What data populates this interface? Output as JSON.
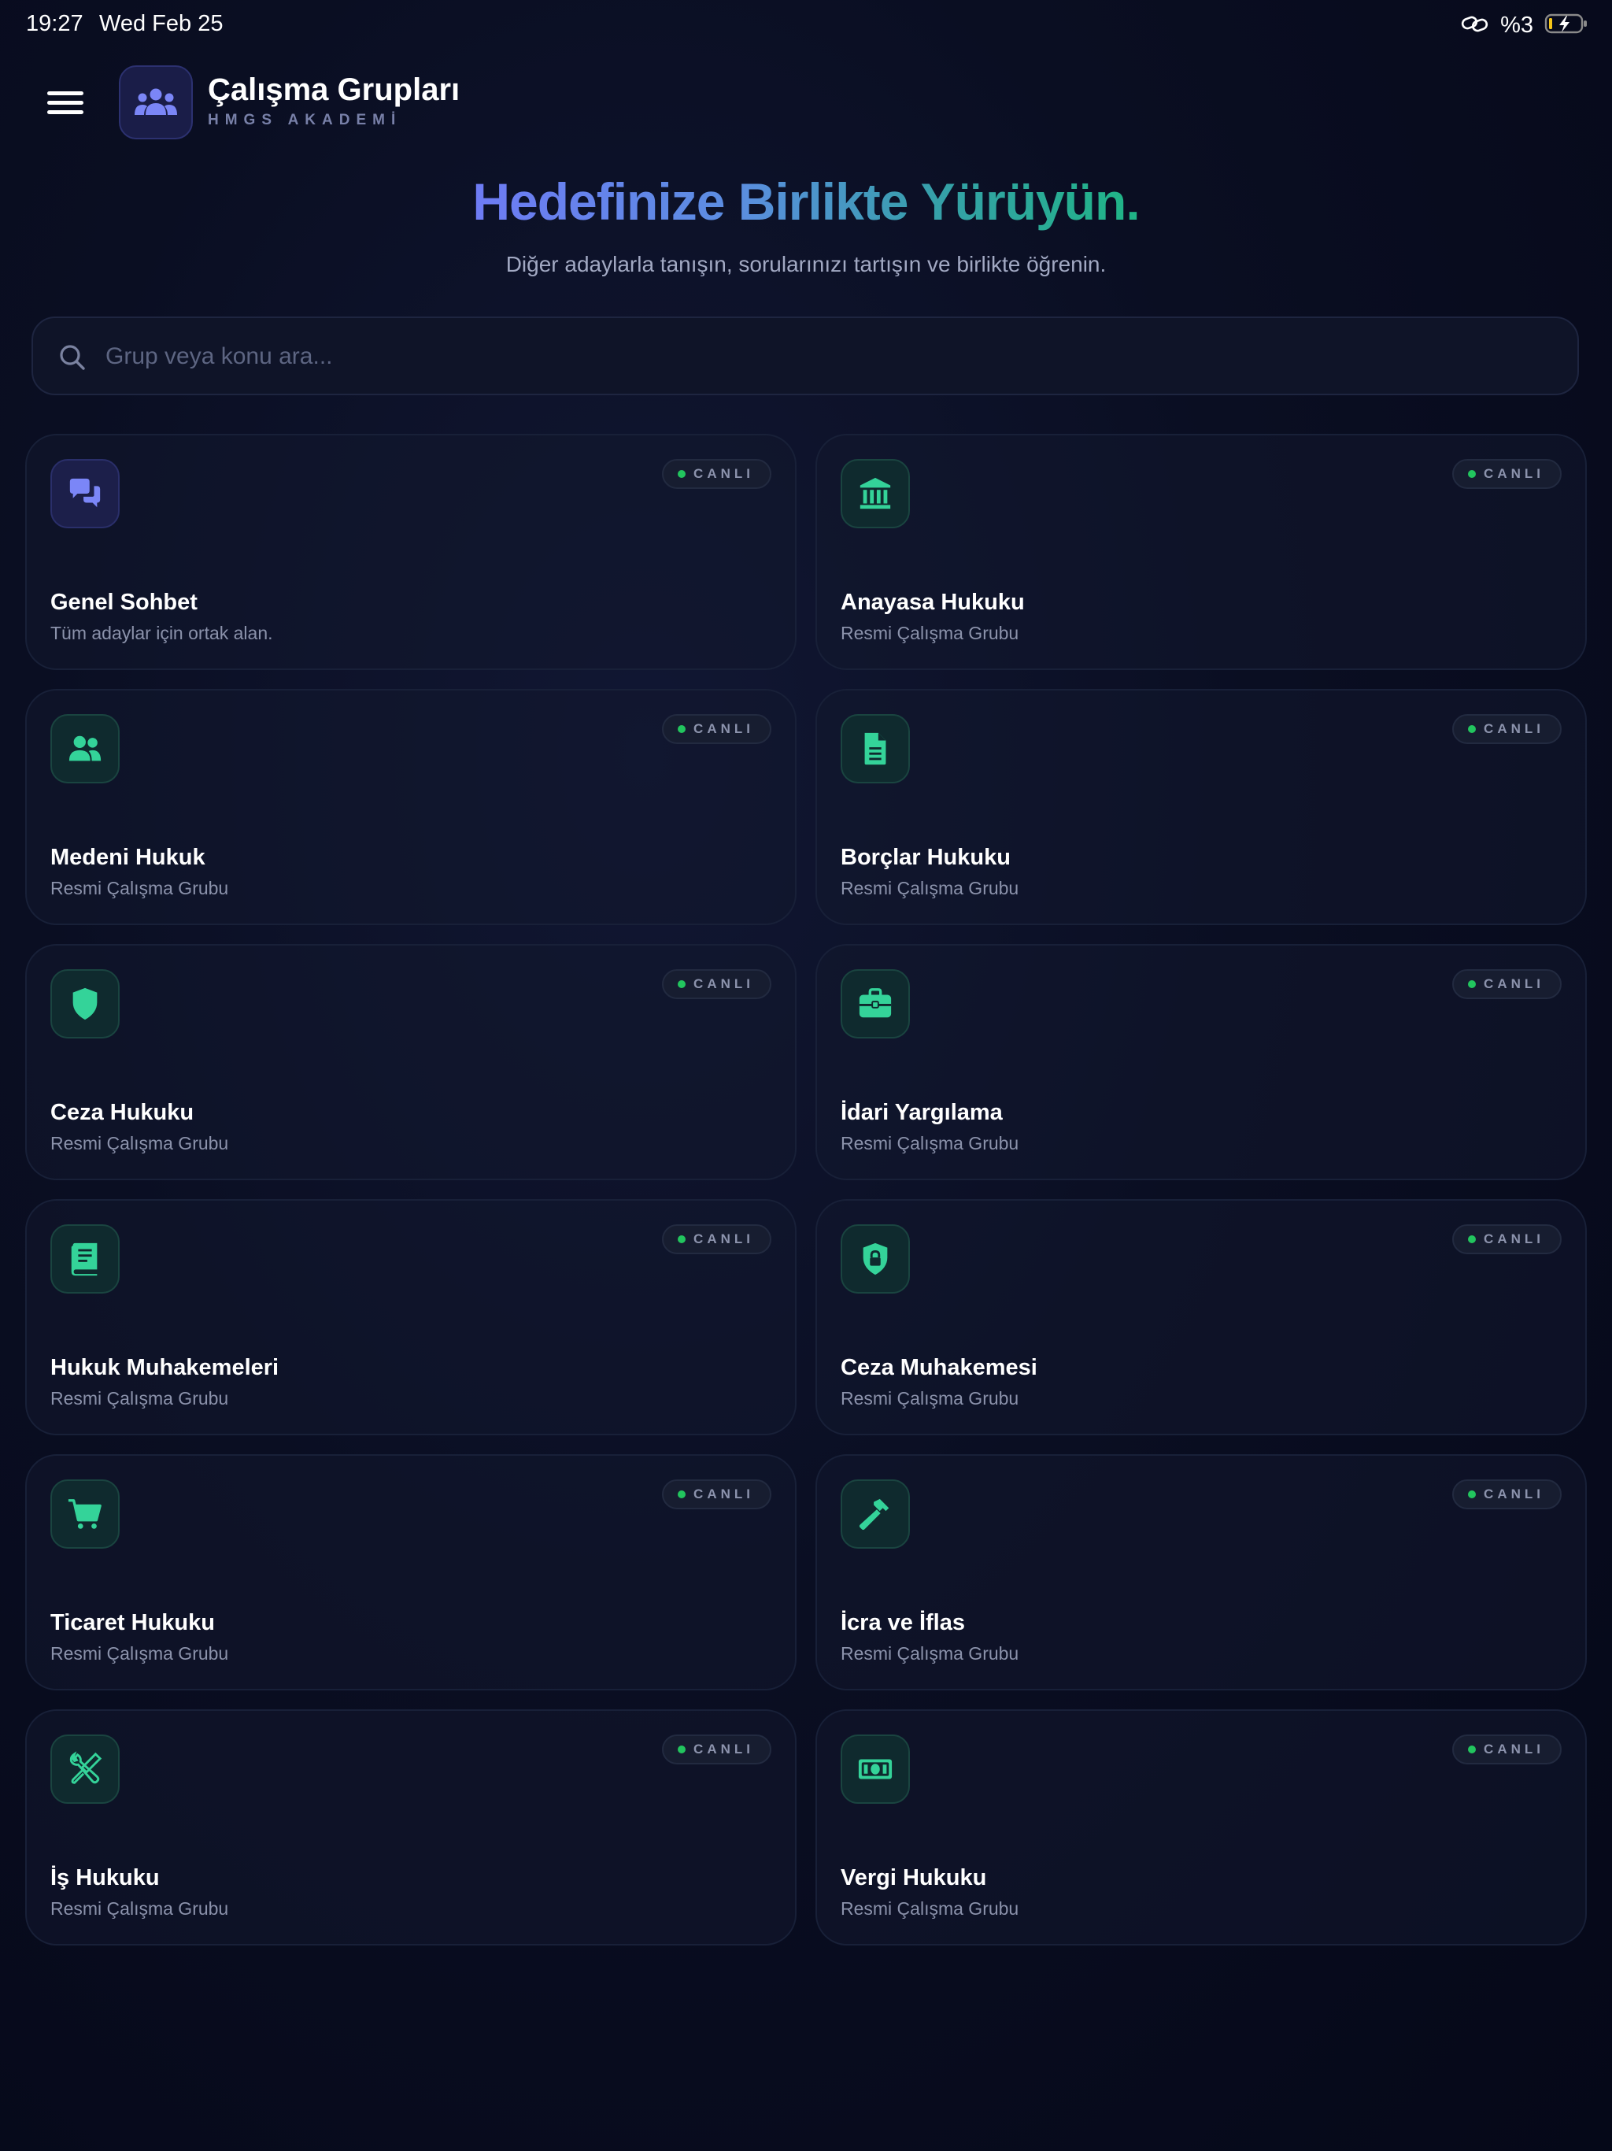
{
  "status_bar": {
    "time": "19:27",
    "date": "Wed Feb 25",
    "battery": "%3"
  },
  "header": {
    "title": "Çalışma Grupları",
    "subtitle": "HMGS AKADEMİ"
  },
  "hero": {
    "title": "Hedefinize Birlikte Yürüyün.",
    "subtitle": "Diğer adaylarla tanışın, sorularınızı tartışın ve birlikte öğrenin."
  },
  "search": {
    "placeholder": "Grup veya konu ara...",
    "value": ""
  },
  "colors": {
    "accent_teal": "#34d399",
    "accent_indigo": "#6e7bf5",
    "live": "#22c55e"
  },
  "groups": [
    {
      "title": "Genel Sohbet",
      "description": "Tüm adaylar için ortak alan.",
      "badge": "CANLI",
      "icon": "chat-bubbles-icon"
    },
    {
      "title": "Anayasa Hukuku",
      "description": "Resmi Çalışma Grubu",
      "badge": "CANLI",
      "icon": "courthouse-icon"
    },
    {
      "title": "Medeni Hukuk",
      "description": "Resmi Çalışma Grubu",
      "badge": "CANLI",
      "icon": "people-icon"
    },
    {
      "title": "Borçlar Hukuku",
      "description": "Resmi Çalışma Grubu",
      "badge": "CANLI",
      "icon": "document-icon"
    },
    {
      "title": "Ceza Hukuku",
      "description": "Resmi Çalışma Grubu",
      "badge": "CANLI",
      "icon": "shield-icon"
    },
    {
      "title": "İdari Yargılama",
      "description": "Resmi Çalışma Grubu",
      "badge": "CANLI",
      "icon": "briefcase-icon"
    },
    {
      "title": "Hukuk Muhakemeleri",
      "description": "Resmi Çalışma Grubu",
      "badge": "CANLI",
      "icon": "book-icon"
    },
    {
      "title": "Ceza Muhakemesi",
      "description": "Resmi Çalışma Grubu",
      "badge": "CANLI",
      "icon": "shield-lock-icon"
    },
    {
      "title": "Ticaret Hukuku",
      "description": "Resmi Çalışma Grubu",
      "badge": "CANLI",
      "icon": "cart-icon"
    },
    {
      "title": "İcra ve İflas",
      "description": "Resmi Çalışma Grubu",
      "badge": "CANLI",
      "icon": "hammer-icon"
    },
    {
      "title": "İş Hukuku",
      "description": "Resmi Çalışma Grubu",
      "badge": "CANLI",
      "icon": "tools-icon"
    },
    {
      "title": "Vergi Hukuku",
      "description": "Resmi Çalışma Grubu",
      "badge": "CANLI",
      "icon": "money-bill-icon"
    }
  ]
}
